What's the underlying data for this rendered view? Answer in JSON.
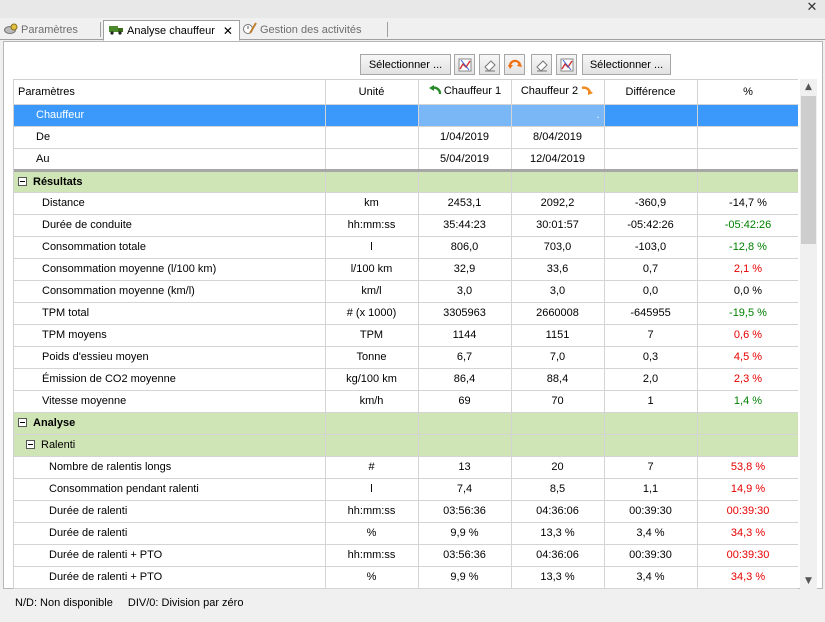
{
  "window": {
    "close_glyph": "✕"
  },
  "tabs": [
    {
      "label": "Paramètres",
      "icon": "gear-car-icon"
    },
    {
      "label": "Analyse chauffeur",
      "icon": "truck-icon",
      "close": "✕"
    },
    {
      "label": "Gestion des activités",
      "icon": "pencil-clock-icon"
    }
  ],
  "toolbar": {
    "select_left": "Sélectionner ...",
    "select_right": "Sélectionner ...",
    "icons": [
      "chart-icon",
      "eraser-icon",
      "swap-icon",
      "eraser-icon",
      "chart-icon"
    ]
  },
  "table": {
    "headers": {
      "param": "Paramètres",
      "unit": "Unité",
      "driver1": "Chauffeur 1",
      "driver2": "Chauffeur 2",
      "diff": "Différence",
      "pct": "%"
    },
    "info": {
      "chauffeur": "Chauffeur",
      "chauffeur_dot": ".",
      "de": "De",
      "de_d1": "1/04/2019",
      "de_d2": "8/04/2019",
      "au": "Au",
      "au_d1": "5/04/2019",
      "au_d2": "12/04/2019"
    },
    "groups": {
      "resultats": "Résultats",
      "analyse": "Analyse",
      "ralenti": "Ralenti"
    },
    "results": [
      {
        "param": "Distance",
        "unit": "km",
        "d1": "2453,1",
        "d2": "2092,2",
        "diff": "-360,9",
        "pct": "-14,7 %",
        "tone": ""
      },
      {
        "param": "Durée de conduite",
        "unit": "hh:mm:ss",
        "d1": "35:44:23",
        "d2": "30:01:57",
        "diff": "-05:42:26",
        "pct": "-05:42:26",
        "tone": "neg"
      },
      {
        "param": "Consommation totale",
        "unit": "l",
        "d1": "806,0",
        "d2": "703,0",
        "diff": "-103,0",
        "pct": "-12,8 %",
        "tone": "neg"
      },
      {
        "param": "Consommation moyenne (l/100 km)",
        "unit": "l/100 km",
        "d1": "32,9",
        "d2": "33,6",
        "diff": "0,7",
        "pct": "2,1 %",
        "tone": "pos"
      },
      {
        "param": "Consommation moyenne (km/l)",
        "unit": "km/l",
        "d1": "3,0",
        "d2": "3,0",
        "diff": "0,0",
        "pct": "0,0 %",
        "tone": ""
      },
      {
        "param": "TPM total",
        "unit": "# (x 1000)",
        "d1": "3305963",
        "d2": "2660008",
        "diff": "-645955",
        "pct": "-19,5 %",
        "tone": "neg"
      },
      {
        "param": "TPM moyens",
        "unit": "TPM",
        "d1": "1144",
        "d2": "1151",
        "diff": "7",
        "pct": "0,6 %",
        "tone": "pos"
      },
      {
        "param": "Poids d'essieu moyen",
        "unit": "Tonne",
        "d1": "6,7",
        "d2": "7,0",
        "diff": "0,3",
        "pct": "4,5 %",
        "tone": "pos"
      },
      {
        "param": "Émission de CO2 moyenne",
        "unit": "kg/100 km",
        "d1": "86,4",
        "d2": "88,4",
        "diff": "2,0",
        "pct": "2,3 %",
        "tone": "pos"
      },
      {
        "param": "Vitesse moyenne",
        "unit": "km/h",
        "d1": "69",
        "d2": "70",
        "diff": "1",
        "pct": "1,4 %",
        "tone": "neg"
      }
    ],
    "ralenti_rows": [
      {
        "param": "Nombre de ralentis longs",
        "unit": "#",
        "d1": "13",
        "d2": "20",
        "diff": "7",
        "pct": "53,8 %",
        "tone": "pos"
      },
      {
        "param": "Consommation pendant ralenti",
        "unit": "l",
        "d1": "7,4",
        "d2": "8,5",
        "diff": "1,1",
        "pct": "14,9 %",
        "tone": "pos"
      },
      {
        "param": "Durée de ralenti",
        "unit": "hh:mm:ss",
        "d1": "03:56:36",
        "d2": "04:36:06",
        "diff": "00:39:30",
        "pct": "00:39:30",
        "tone": "pos"
      },
      {
        "param": "Durée de ralenti",
        "unit": "%",
        "d1": "9,9 %",
        "d2": "13,3 %",
        "diff": "3,4 %",
        "pct": "34,3 %",
        "tone": "pos"
      },
      {
        "param": "Durée de ralenti + PTO",
        "unit": "hh:mm:ss",
        "d1": "03:56:36",
        "d2": "04:36:06",
        "diff": "00:39:30",
        "pct": "00:39:30",
        "tone": "pos"
      },
      {
        "param": "Durée de ralenti + PTO",
        "unit": "%",
        "d1": "9,9 %",
        "d2": "13,3 %",
        "diff": "3,4 %",
        "pct": "34,3 %",
        "tone": "pos"
      }
    ]
  },
  "footer": {
    "nd": "N/D: Non disponible",
    "div0": "DIV/0: Division par zéro"
  },
  "colors": {
    "selection": "#3b99fc",
    "group": "#cfe5b5",
    "negative": "#008000",
    "positive": "#e60000"
  }
}
